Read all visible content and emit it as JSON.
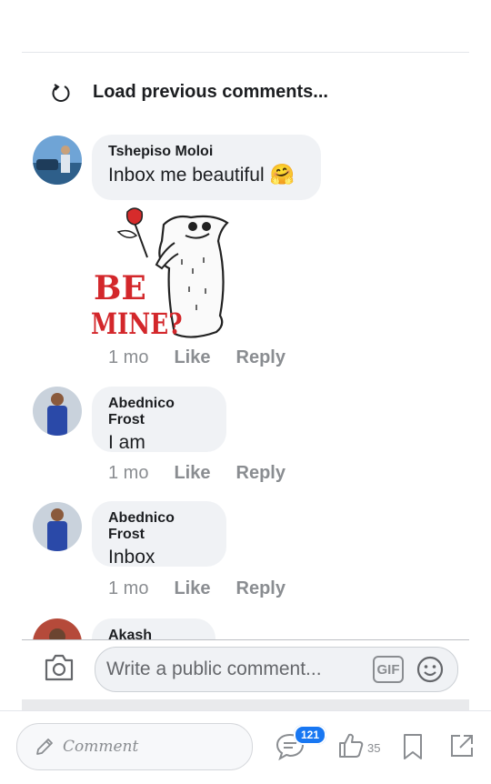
{
  "load_previous": {
    "label": "Load previous comments..."
  },
  "comments": [
    {
      "author": "Tshepiso Moloi",
      "text": "Inbox me beautiful",
      "emoji": "🤗",
      "sticker_text": "BE MINE?",
      "time": "1 mo",
      "like": "Like",
      "reply": "Reply"
    },
    {
      "author": "Abednico Frost",
      "text": "I am",
      "time": "1 mo",
      "like": "Like",
      "reply": "Reply"
    },
    {
      "author": "Abednico Frost",
      "text": "Inbox",
      "time": "1 mo",
      "like": "Like",
      "reply": "Reply"
    },
    {
      "author": "Akash Haque"
    }
  ],
  "composer": {
    "placeholder": "Write a public comment...",
    "gif_label": "GIF"
  },
  "bottom_bar": {
    "comment_label": "Comment",
    "comments_count": "121",
    "likes_count": "35"
  },
  "colors": {
    "accent": "#1877f2",
    "bubble": "#f0f2f5",
    "meta": "#8a8d91"
  }
}
